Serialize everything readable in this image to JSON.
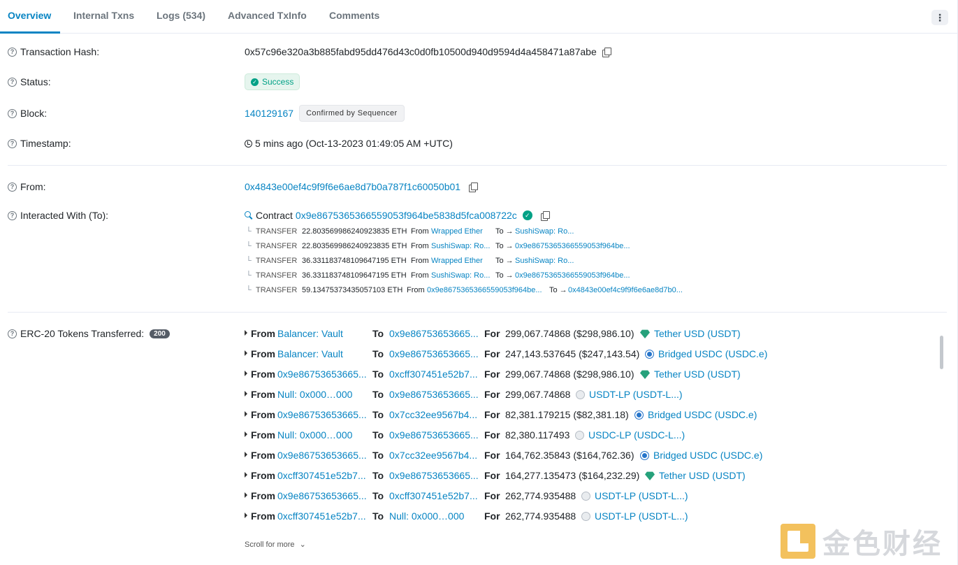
{
  "tabs": [
    {
      "label": "Overview",
      "active": true
    },
    {
      "label": "Internal Txns"
    },
    {
      "label": "Logs (534)"
    },
    {
      "label": "Advanced TxInfo"
    },
    {
      "label": "Comments"
    }
  ],
  "more_icon": "⋮",
  "tx": {
    "hash_label": "Transaction Hash:",
    "hash": "0x57c96e320a3b885fabd95dd476d43c0d0fb10500d940d9594d4a458471a87abe",
    "status_label": "Status:",
    "status": "Success",
    "block_label": "Block:",
    "block": "140129167",
    "block_badge": "Confirmed by Sequencer",
    "timestamp_label": "Timestamp:",
    "timestamp": "5 mins ago (Oct-13-2023 01:49:05 AM +UTC)",
    "from_label": "From:",
    "from": "0x4843e00ef4c9f9f6e6ae8d7b0a787f1c60050b01",
    "to_label": "Interacted With (To):",
    "contract_word": "Contract",
    "contract": "0x9e8675365366559053f964be5838d5fca008722c"
  },
  "transfers": [
    {
      "type": "TRANSFER",
      "amount": "22.803569986240923835 ETH",
      "from_word": "From",
      "from": "Wrapped Ether",
      "to_word": "To →",
      "to": "SushiSwap: Ro..."
    },
    {
      "type": "TRANSFER",
      "amount": "22.803569986240923835 ETH",
      "from_word": "From",
      "from": "SushiSwap: Ro...",
      "to_word": "To →",
      "to": "0x9e8675365366559053f964be..."
    },
    {
      "type": "TRANSFER",
      "amount": "36.331183748109647195 ETH",
      "from_word": "From",
      "from": "Wrapped Ether",
      "to_word": "To →",
      "to": "SushiSwap: Ro..."
    },
    {
      "type": "TRANSFER",
      "amount": "36.331183748109647195 ETH",
      "from_word": "From",
      "from": "SushiSwap: Ro...",
      "to_word": "To →",
      "to": "0x9e8675365366559053f964be..."
    },
    {
      "type": "TRANSFER",
      "amount": "59.13475373435057103 ETH",
      "from_word": "From",
      "from": "0x9e8675365366559053f964be...",
      "to_word": "To →",
      "to": "0x4843e00ef4c9f9f6e6ae8d7b0..."
    }
  ],
  "erc20": {
    "label": "ERC-20 Tokens Transferred:",
    "count": "200",
    "kw_from": "From",
    "kw_to": "To",
    "kw_for": "For",
    "rows": [
      {
        "from": "Balancer: Vault",
        "to": "0x9e86753653665...",
        "amount": "299,067.74868 ($298,986.10)",
        "token": "Tether USD (USDT)",
        "icon": "usdt"
      },
      {
        "from": "Balancer: Vault",
        "to": "0x9e86753653665...",
        "amount": "247,143.537645 ($247,143.54)",
        "token": "Bridged USDC (USDC.e)",
        "icon": "usdc"
      },
      {
        "from": "0x9e86753653665...",
        "to": "0xcff307451e52b7...",
        "amount": "299,067.74868 ($298,986.10)",
        "token": "Tether USD (USDT)",
        "icon": "usdt"
      },
      {
        "from": "Null: 0x000…000",
        "to": "0x9e86753653665...",
        "amount": "299,067.74868",
        "token": "USDT-LP (USDT-L...)",
        "icon": "lp"
      },
      {
        "from": "0x9e86753653665...",
        "to": "0x7cc32ee9567b4...",
        "amount": "82,381.179215 ($82,381.18)",
        "token": "Bridged USDC (USDC.e)",
        "icon": "usdc"
      },
      {
        "from": "Null: 0x000…000",
        "to": "0x9e86753653665...",
        "amount": "82,380.117493",
        "token": "USDC-LP (USDC-L...)",
        "icon": "lp"
      },
      {
        "from": "0x9e86753653665...",
        "to": "0x7cc32ee9567b4...",
        "amount": "164,762.35843 ($164,762.36)",
        "token": "Bridged USDC (USDC.e)",
        "icon": "usdc"
      },
      {
        "from": "0xcff307451e52b7...",
        "to": "0x9e86753653665...",
        "amount": "164,277.135473 ($164,232.29)",
        "token": "Tether USD (USDT)",
        "icon": "usdt"
      },
      {
        "from": "0x9e86753653665...",
        "to": "0xcff307451e52b7...",
        "amount": "262,774.935488",
        "token": "USDT-LP (USDT-L...)",
        "icon": "lp"
      },
      {
        "from": "0xcff307451e52b7...",
        "to": "Null: 0x000…000",
        "amount": "262,774.935488",
        "token": "USDT-LP (USDT-L...)",
        "icon": "lp"
      }
    ],
    "scroll_more": "Scroll for more"
  },
  "watermark": {
    "text": "金色财经"
  }
}
